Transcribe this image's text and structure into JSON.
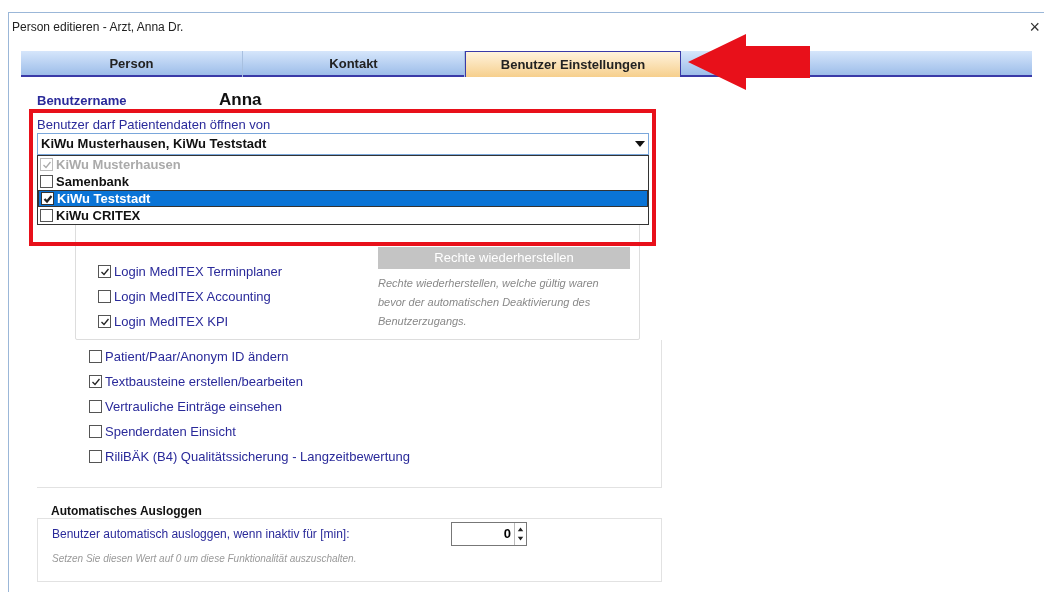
{
  "window": {
    "title": "Person editieren - Arzt, Anna Dr.",
    "close": "×"
  },
  "tabs": [
    {
      "label": "Person",
      "selected": false
    },
    {
      "label": "Kontakt",
      "selected": false
    },
    {
      "label": "Benutzer Einstellungen",
      "selected": true
    }
  ],
  "username": {
    "label": "Benutzername",
    "value": "Anna"
  },
  "patient_access": {
    "label": "Benutzer darf Patientendaten öffnen von",
    "value": "KiWu Musterhausen, KiWu Teststadt",
    "expanded": true,
    "options": [
      {
        "label": "KiWu Musterhausen",
        "checked": true,
        "disabled": true,
        "selected": false
      },
      {
        "label": "Samenbank",
        "checked": false,
        "disabled": false,
        "selected": false
      },
      {
        "label": "KiWu Teststadt",
        "checked": true,
        "disabled": false,
        "selected": true
      },
      {
        "label": "KiWu CRITEX",
        "checked": false,
        "disabled": false,
        "selected": false
      }
    ]
  },
  "logins": [
    {
      "label": "Login MedITEX Terminplaner",
      "checked": true
    },
    {
      "label": "Login MedITEX Accounting",
      "checked": false
    },
    {
      "label": "Login MedITEX KPI",
      "checked": true
    }
  ],
  "restore": {
    "button": "Rechte wiederherstellen",
    "disabled": true,
    "note": "Rechte wiederherstellen, welche gültig waren bevor der automatischen Deaktivierung des Benutzerzugangs."
  },
  "permissions": [
    {
      "label": "Patient/Paar/Anonym ID ändern",
      "checked": false
    },
    {
      "label": "Textbausteine erstellen/bearbeiten",
      "checked": true
    },
    {
      "label": "Vertrauliche Einträge einsehen",
      "checked": false
    },
    {
      "label": "Spenderdaten Einsicht",
      "checked": false
    },
    {
      "label": "RiliBÄK (B4) Qualitätssicherung - Langzeitbewertung",
      "checked": false
    }
  ],
  "auto_logout": {
    "title": "Automatisches Ausloggen",
    "label": "Benutzer automatisch ausloggen, wenn inaktiv für [min]:",
    "value": "0",
    "note": "Setzen Sie diesen Wert auf 0 um diese Funktionalität auszuschalten."
  }
}
